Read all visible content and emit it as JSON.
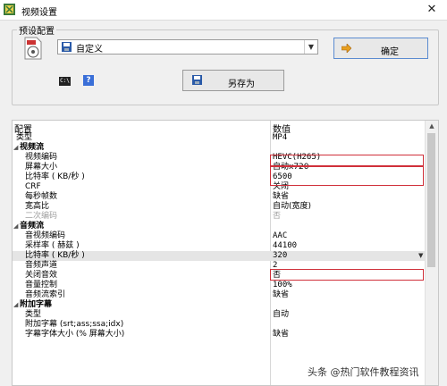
{
  "window": {
    "title": "视频设置",
    "close_glyph": "✕"
  },
  "preset": {
    "group_label": "预设配置",
    "selected": "自定义",
    "ok_label": "确定",
    "save_as_label": "另存为",
    "cmd_icon_text": "C:\\"
  },
  "grid": {
    "header_col1": "配置",
    "header_col2": "数值",
    "rows": [
      {
        "k": "类型",
        "v": "MP4"
      },
      {
        "k": "视频流",
        "v": ""
      },
      {
        "k": "视频编码",
        "v": "HEVC(H265)"
      },
      {
        "k": "屏幕大小",
        "v": "自动x720"
      },
      {
        "k": "比特率 ( KB/秒 )",
        "v": "6500"
      },
      {
        "k": "CRF",
        "v": "关闭"
      },
      {
        "k": "每秒帧数",
        "v": "缺省"
      },
      {
        "k": "宽高比",
        "v": "自动(宽度)"
      },
      {
        "k": "二次编码",
        "v": "否"
      },
      {
        "k": "音频流",
        "v": ""
      },
      {
        "k": "音视频编码",
        "v": "AAC"
      },
      {
        "k": "采样率 ( 赫兹 )",
        "v": "44100"
      },
      {
        "k": "比特率 ( KB/秒 )",
        "v": "320"
      },
      {
        "k": "音频声道",
        "v": "2"
      },
      {
        "k": "关闭音效",
        "v": "否"
      },
      {
        "k": "音量控制",
        "v": "100%"
      },
      {
        "k": "音频流索引",
        "v": "缺省"
      },
      {
        "k": "附加字幕",
        "v": ""
      },
      {
        "k": "类型",
        "v": "自动"
      },
      {
        "k": "附加字幕 (srt;ass;ssa;idx)",
        "v": ""
      },
      {
        "k": "字幕字体大小 (% 屏幕大小)",
        "v": "缺省"
      }
    ]
  },
  "watermark": "头条 @热门软件教程资讯",
  "colors": {
    "highlight": "#d0303a",
    "accent": "#3a6fd8"
  }
}
